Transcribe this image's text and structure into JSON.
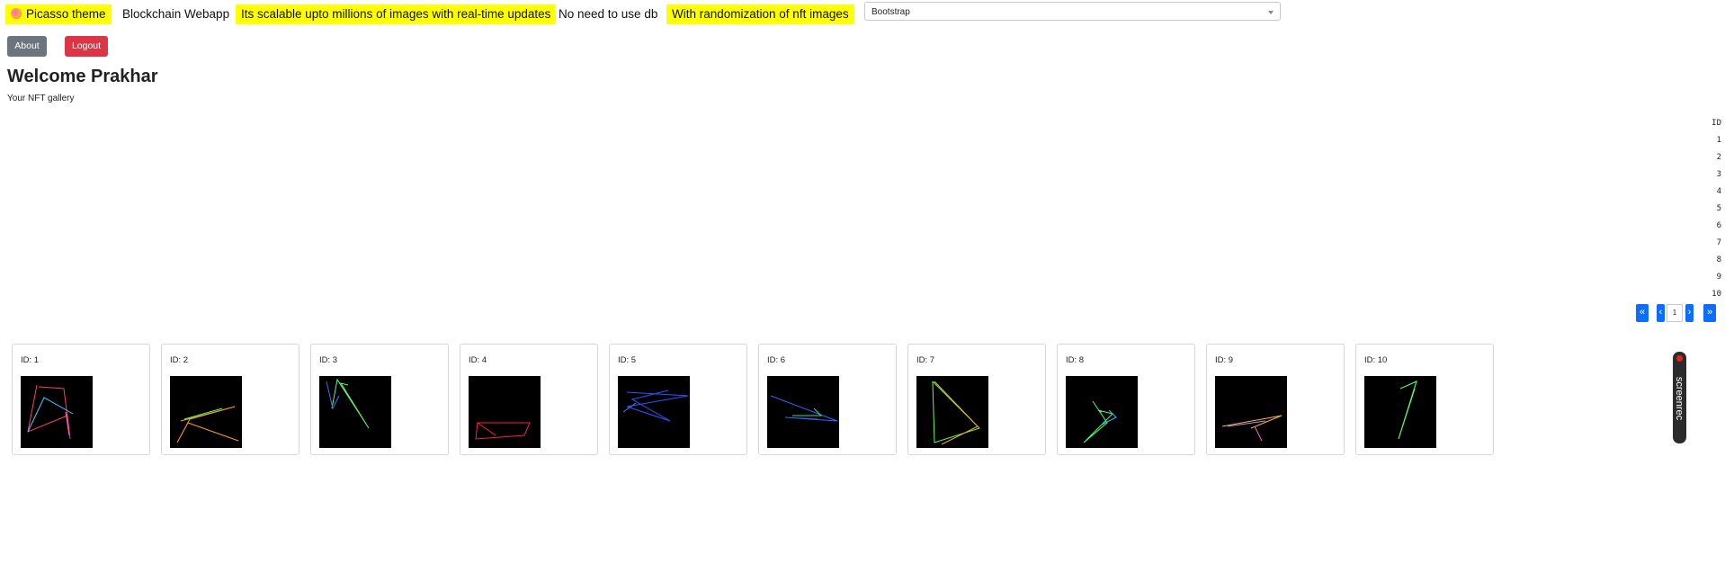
{
  "header": {
    "items": [
      {
        "label": "Picasso theme",
        "highlight": true
      },
      {
        "label": "Blockchain Webapp",
        "highlight": false
      },
      {
        "label": "Its scalable upto millions of images with real-time updates",
        "highlight": true
      },
      {
        "label": "No need to use db",
        "highlight": false
      },
      {
        "label": "With randomization of nft images",
        "highlight": true
      }
    ],
    "theme_select": {
      "value": "Bootstrap"
    }
  },
  "buttons": {
    "about": "About",
    "logout": "Logout"
  },
  "welcome": {
    "title": "Welcome Prakhar",
    "subtitle": "Your NFT gallery"
  },
  "id_column": {
    "header": "ID",
    "values": [
      "1",
      "2",
      "3",
      "4",
      "5",
      "6",
      "7",
      "8",
      "9",
      "10"
    ]
  },
  "pagination": {
    "first": "«",
    "prev": "‹",
    "page": "1",
    "next": "›",
    "last": "»"
  },
  "gallery": {
    "cards": [
      {
        "label": "ID: 1"
      },
      {
        "label": "ID: 2"
      },
      {
        "label": "ID: 3"
      },
      {
        "label": "ID: 4"
      },
      {
        "label": "ID: 5"
      },
      {
        "label": "ID: 6"
      },
      {
        "label": "ID: 7"
      },
      {
        "label": "ID: 8"
      },
      {
        "label": "ID: 9"
      },
      {
        "label": "ID: 10"
      }
    ]
  },
  "recorder": {
    "brand": "screenrec"
  },
  "colors": {
    "highlight": "#ffff00",
    "primary": "#0d6efd",
    "secondary": "#6c757d",
    "danger": "#dc3545"
  }
}
